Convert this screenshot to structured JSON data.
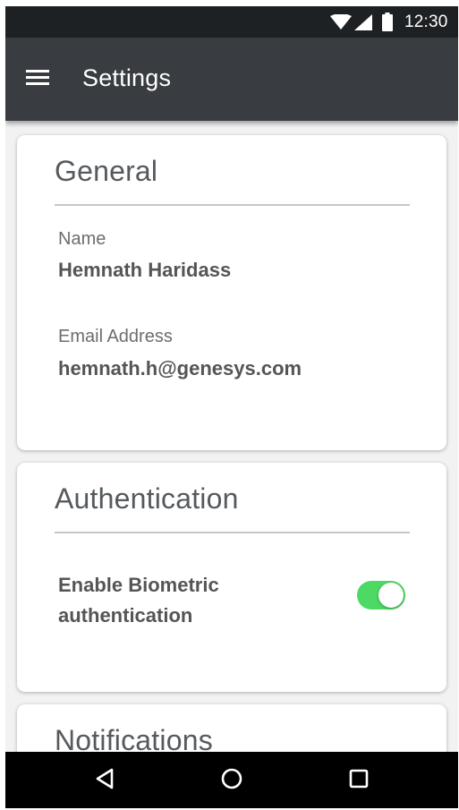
{
  "status_bar": {
    "time": "12:30",
    "icons": [
      "wifi-icon",
      "cell-signal-icon",
      "battery-icon"
    ]
  },
  "app_bar": {
    "title": "Settings",
    "menu_icon": "menu-icon"
  },
  "general": {
    "title": "General",
    "name_label": "Name",
    "name_value": "Hemnath Haridass",
    "email_label": "Email Address",
    "email_value": "hemnath.h@genesys.com"
  },
  "authentication": {
    "title": "Authentication",
    "biometric_label": "Enable Biometric authentication",
    "biometric_enabled": true
  },
  "notifications": {
    "title": "Notifications"
  },
  "nav_bar": {
    "icons": [
      "back-icon",
      "home-icon",
      "recents-icon"
    ]
  },
  "colors": {
    "status_bar": "#1e2124",
    "app_bar": "#393d42",
    "background": "#f2f2f2",
    "card": "#ffffff",
    "toggle_on": "#4cd964",
    "nav_bar": "#000000"
  }
}
